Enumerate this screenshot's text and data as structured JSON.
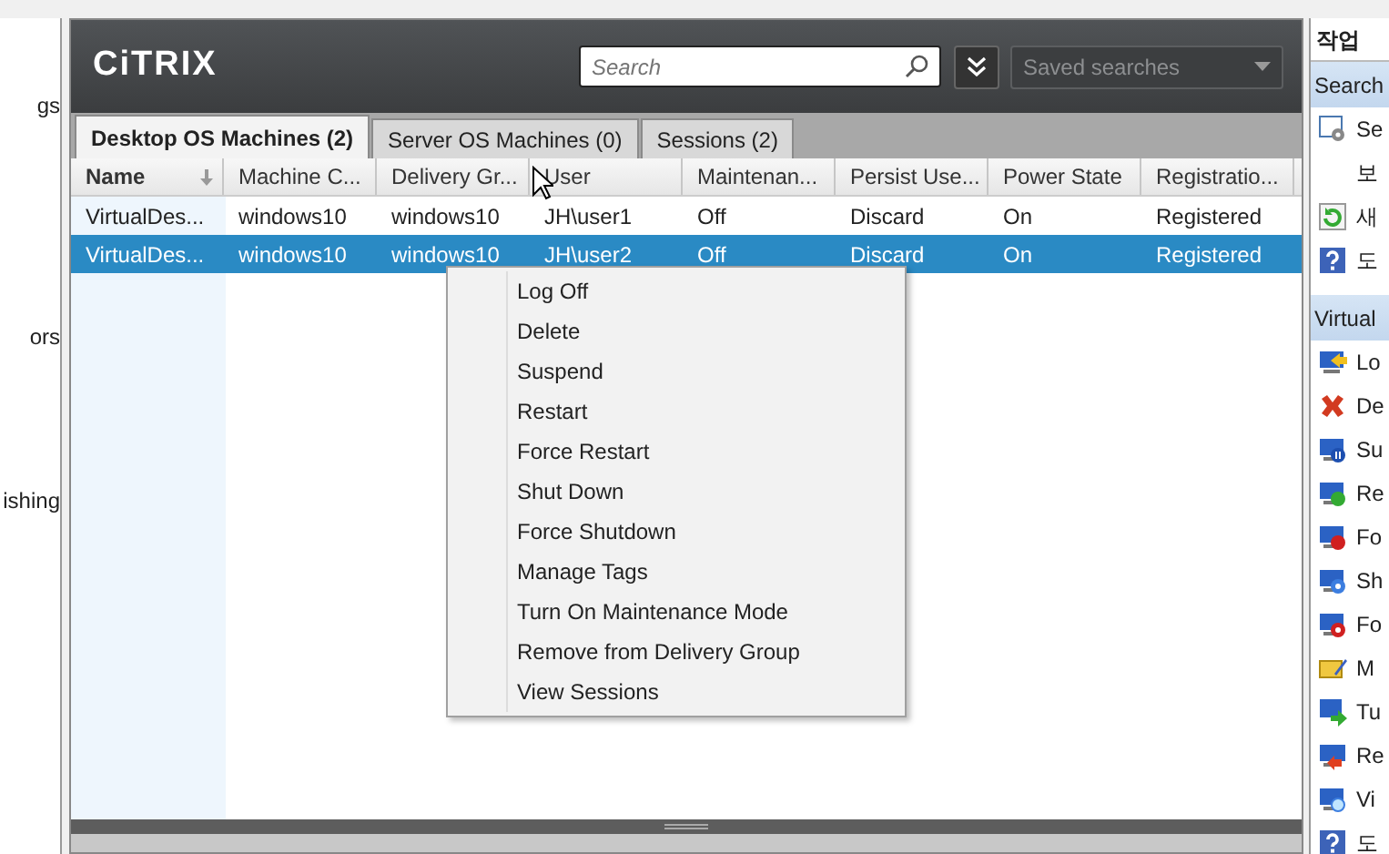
{
  "left_pane": {
    "items": [
      "gs",
      "ors",
      "ishing"
    ]
  },
  "header": {
    "logo": "CiTRIX",
    "search": {
      "placeholder": "Search"
    },
    "saved_searches": {
      "placeholder": "Saved searches"
    }
  },
  "tabs": [
    {
      "label": "Desktop OS Machines (2)",
      "selected": true
    },
    {
      "label": "Server OS Machines (0)",
      "selected": false
    },
    {
      "label": "Sessions (2)",
      "selected": false
    }
  ],
  "table": {
    "columns": [
      {
        "label": "Name",
        "sorted": true
      },
      {
        "label": "Machine C...",
        "sorted": false
      },
      {
        "label": "Delivery Gr...",
        "sorted": false
      },
      {
        "label": "User",
        "sorted": false
      },
      {
        "label": "Maintenan...",
        "sorted": false
      },
      {
        "label": "Persist Use...",
        "sorted": false
      },
      {
        "label": "Power State",
        "sorted": false
      },
      {
        "label": "Registratio...",
        "sorted": false
      }
    ],
    "rows": [
      {
        "selected": false,
        "cells": [
          "VirtualDes...",
          "windows10",
          "windows10",
          "JH\\user1",
          "Off",
          "Discard",
          "On",
          "Registered"
        ]
      },
      {
        "selected": true,
        "cells": [
          "VirtualDes...",
          "windows10",
          "windows10",
          "JH\\user2",
          "Off",
          "Discard",
          "On",
          "Registered"
        ]
      }
    ]
  },
  "context_menu": {
    "items": [
      "Log Off",
      "Delete",
      "Suspend",
      "Restart",
      "Force Restart",
      "Shut Down",
      "Force Shutdown",
      "Manage Tags",
      "Turn On Maintenance Mode",
      "Remove from Delivery Group",
      "View Sessions"
    ]
  },
  "actions_pane": {
    "title": "작업",
    "sections": [
      {
        "title": "Search",
        "items": [
          {
            "kind": "search-settings",
            "label": "Se"
          },
          {
            "kind": "plain",
            "label": "보"
          },
          {
            "kind": "refresh",
            "label": "새"
          },
          {
            "kind": "help",
            "label": "도"
          }
        ]
      },
      {
        "title": "Virtual",
        "items": [
          {
            "kind": "logoff",
            "label": "Lo"
          },
          {
            "kind": "delete",
            "label": "De"
          },
          {
            "kind": "suspend",
            "label": "Su"
          },
          {
            "kind": "restart",
            "label": "Re"
          },
          {
            "kind": "force-restart",
            "label": "Fo"
          },
          {
            "kind": "shutdown",
            "label": "Sh"
          },
          {
            "kind": "force-shutdown",
            "label": "Fo"
          },
          {
            "kind": "tags",
            "label": "M"
          },
          {
            "kind": "maintenance",
            "label": "Tu"
          },
          {
            "kind": "remove",
            "label": "Re"
          },
          {
            "kind": "sessions",
            "label": "Vi"
          },
          {
            "kind": "help",
            "label": "도"
          }
        ]
      }
    ]
  }
}
